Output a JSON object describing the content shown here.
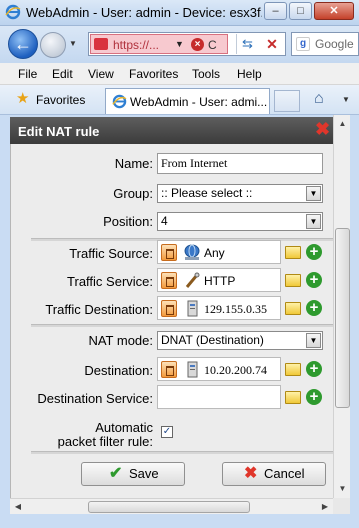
{
  "window": {
    "title": "WebAdmin - User: admin - Device: esx3f...",
    "buttons": {
      "minimize": "–",
      "maximize": "□",
      "close": "✕"
    }
  },
  "nav": {
    "url": "https://...",
    "cert_label": "C",
    "search_engine": "Google",
    "refresh_glyph": "⇆",
    "stop_glyph": "✕"
  },
  "menu": [
    "File",
    "Edit",
    "View",
    "Favorites",
    "Tools",
    "Help"
  ],
  "favorites_bar": {
    "favorites_label": "Favorites",
    "tab_title": "WebAdmin - User: admi..."
  },
  "dialog": {
    "title": "Edit NAT rule",
    "fields": {
      "name": {
        "label": "Name:",
        "value": "From Internet"
      },
      "group": {
        "label": "Group:",
        "value": ":: Please select ::"
      },
      "position": {
        "label": "Position:",
        "value": "4"
      },
      "traffic_source": {
        "label": "Traffic Source:",
        "value": "Any",
        "icon": "network-any-icon"
      },
      "traffic_service": {
        "label": "Traffic Service:",
        "value": "HTTP",
        "icon": "service-icon"
      },
      "traffic_destination": {
        "label": "Traffic Destination:",
        "value": "129.155.0.35",
        "icon": "host-icon"
      },
      "nat_mode": {
        "label": "NAT mode:",
        "value": "DNAT (Destination)"
      },
      "destination": {
        "label": "Destination:",
        "value": "10.20.200.74",
        "icon": "host-icon"
      },
      "destination_service": {
        "label": "Destination Service:",
        "value": ""
      },
      "auto_packet_filter": {
        "label_line1": "Automatic",
        "label_line2": "packet filter rule:",
        "checked": true
      }
    },
    "buttons": {
      "save": "Save",
      "cancel": "Cancel"
    }
  },
  "colors": {
    "dialog_header": "#4a4a4a",
    "accent_green": "#2e9a2e",
    "accent_red": "#e0362b",
    "trash_orange": "#f39a3c"
  }
}
